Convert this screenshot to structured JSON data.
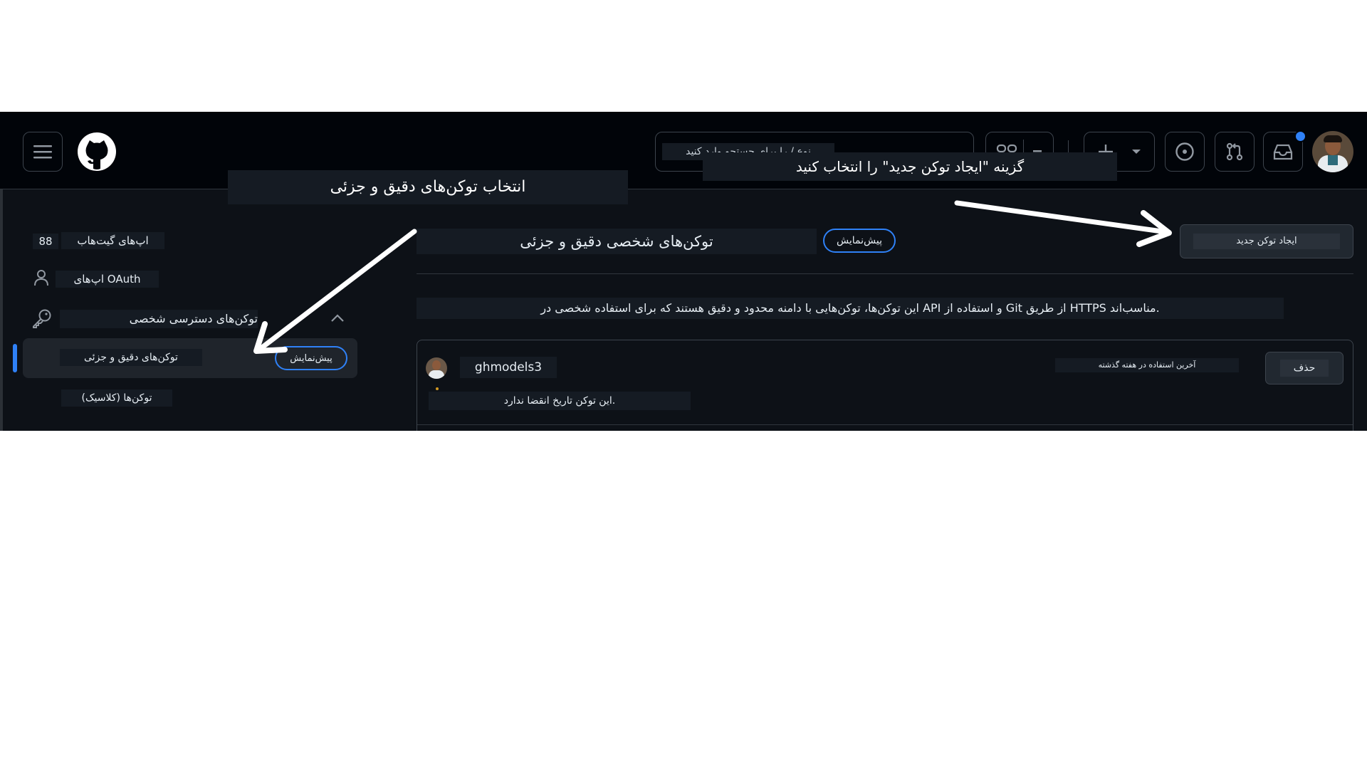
{
  "header": {
    "search_placeholder": "نوع / را برای جستجو وارد کنید",
    "icons": [
      "hamburger-icon",
      "github-logo-icon",
      "copilot-icon",
      "chevron-down-icon",
      "plus-icon",
      "issues-icon",
      "pull-request-icon",
      "inbox-icon",
      "avatar"
    ]
  },
  "annotations": {
    "top_callout": "گزینه \"ایجاد توکن جدید\" را انتخاب کنید",
    "left_callout": "انتخاب توکن‌های دقیق و جزئی"
  },
  "sidebar": {
    "github_apps_label": "اپ‌های گیت‌هاب",
    "github_apps_count": "88",
    "oauth_apps_label": "اپ‌های OAuth",
    "pat_label": "توکن‌های دسترسی شخصی",
    "fine_grained_label": "توکن‌های دقیق و جزئی",
    "preview_badge": "پیش‌نمایش",
    "classic_label": "توکن‌ها (کلاسیک)"
  },
  "main": {
    "title": "توکن‌های شخصی دقیق و جزئی",
    "preview_badge": "پیش‌نمایش",
    "new_token_button": "ایجاد توکن جدید",
    "description": "این توکن‌ها، توکن‌هایی با دامنه محدود و دقیق هستند که برای استفاده شخصی در API و استفاده از Git از طریق HTTPS مناسب‌اند.",
    "token": {
      "name": "ghmodels3",
      "last_used": "آخرین استفاده در هفته گذشته",
      "expiry": "این توکن تاریخ انقضا ندارد.",
      "delete_button": "حذف"
    }
  },
  "colors": {
    "background": "#0d1117",
    "header_bg": "#010409",
    "accent": "#2f81f7",
    "border": "#3d444d"
  }
}
